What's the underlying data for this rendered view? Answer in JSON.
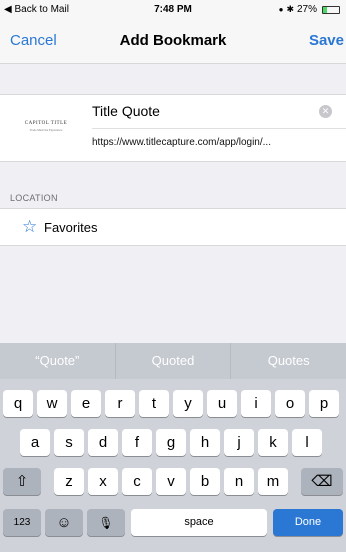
{
  "status_bar": {
    "back_label": "◀ Back to Mail",
    "time": "7:48 PM",
    "battery": "27%",
    "battery_level": 0.27
  },
  "nav": {
    "cancel_label": "Cancel",
    "title": "Add Bookmark",
    "save_label": "Save"
  },
  "bookmark": {
    "thumbnail_text": "CAPITOL TITLE",
    "thumbnail_subtext": "Trade Mark the Experience",
    "title_value": "Title Quote",
    "url": "https://www.titlecapture.com/app/login/..."
  },
  "location": {
    "section_label": "LOCATION",
    "favorites_label": "Favorites"
  },
  "keyboard": {
    "suggestions": [
      "“Quote”",
      "Quoted",
      "Quotes"
    ],
    "row1": [
      "q",
      "w",
      "e",
      "r",
      "t",
      "y",
      "u",
      "i",
      "o",
      "p"
    ],
    "row2": [
      "a",
      "s",
      "d",
      "f",
      "g",
      "h",
      "j",
      "k",
      "l"
    ],
    "row3": [
      "z",
      "x",
      "c",
      "v",
      "b",
      "n",
      "m"
    ],
    "numbers_label": "123",
    "space_label": "space",
    "done_label": "Done"
  }
}
